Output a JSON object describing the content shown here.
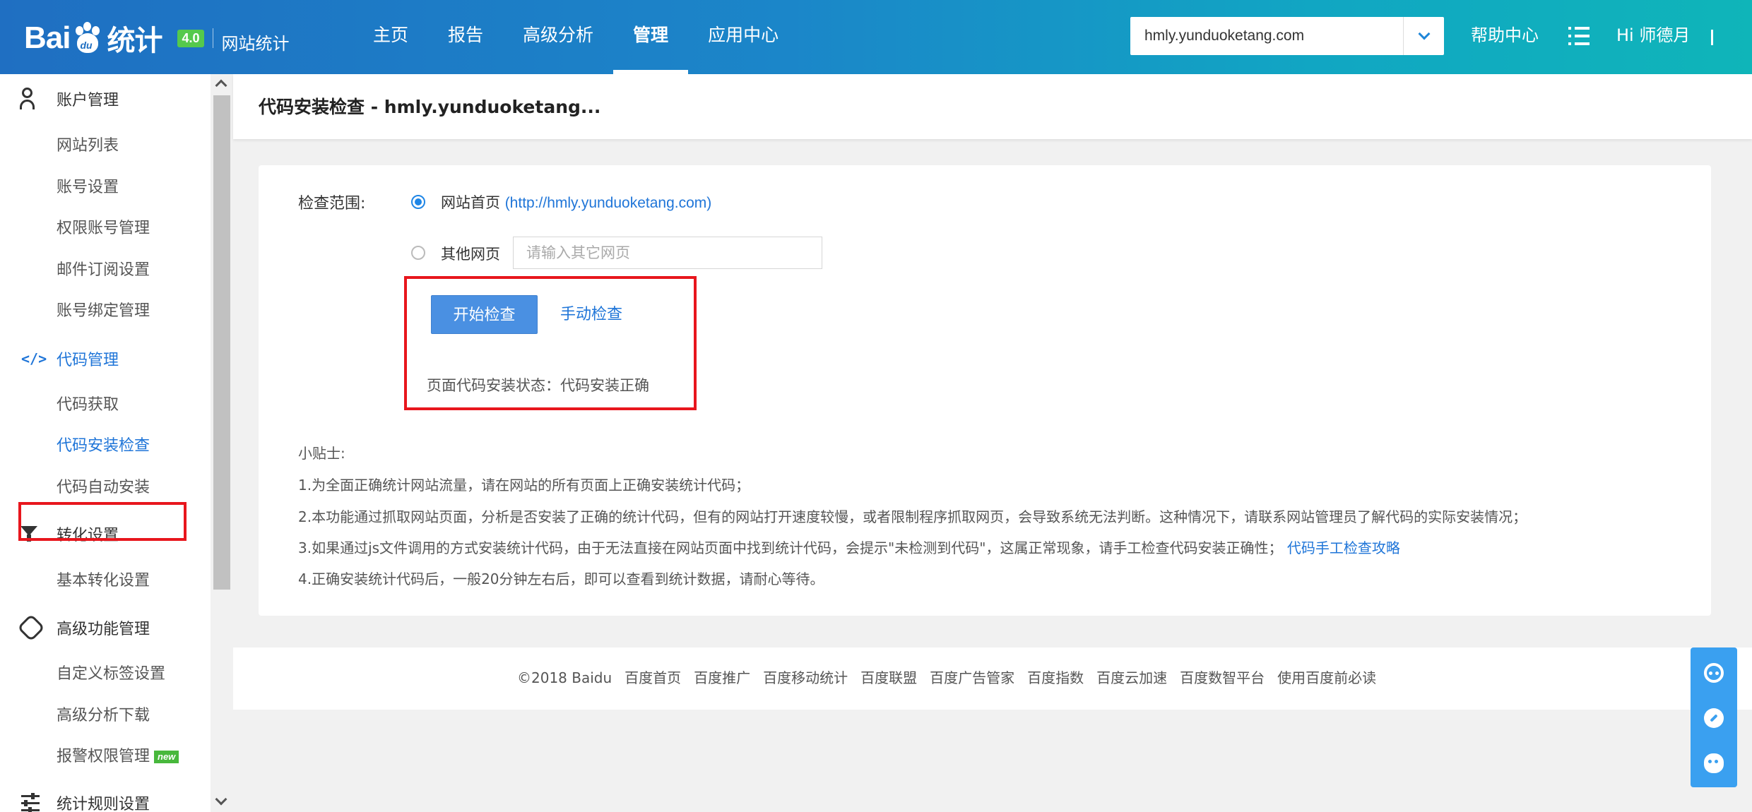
{
  "header": {
    "logo_text_a": "Bai",
    "logo_paw_text": "du",
    "logo_text_b": "统计",
    "logo_badge": "4.0",
    "logo_sub": "网站统计",
    "nav": [
      {
        "label": "主页",
        "active": false
      },
      {
        "label": "报告",
        "active": false
      },
      {
        "label": "高级分析",
        "active": false
      },
      {
        "label": "管理",
        "active": true
      },
      {
        "label": "应用中心",
        "active": false
      }
    ],
    "site_select_value": "hmly.yunduoketang.com",
    "help": "帮助中心",
    "greeting": "Hi 师德月"
  },
  "sidebar": {
    "groups": [
      {
        "label": "账户管理",
        "icon": "user-icon"
      },
      {
        "label": "代码管理",
        "icon": "code-icon"
      },
      {
        "label": "转化设置",
        "icon": "funnel-icon"
      },
      {
        "label": "高级功能管理",
        "icon": "puzzle-icon"
      },
      {
        "label": "统计规则设置",
        "icon": "sliders-icon"
      }
    ],
    "account_items": [
      "网站列表",
      "账号设置",
      "权限账号管理",
      "邮件订阅设置",
      "账号绑定管理"
    ],
    "code_items": [
      "代码获取",
      "代码安装检查",
      "代码自动安装"
    ],
    "conversion_items": [
      "基本转化设置"
    ],
    "advanced_items": [
      "自定义标签设置",
      "高级分析下载",
      "报警权限管理"
    ],
    "new_badge": "new",
    "active_item": "代码安装检查"
  },
  "main": {
    "page_title": "代码安装检查 - hmly.yunduoketang...",
    "range_label": "检查范围:",
    "option_home": "网站首页",
    "option_home_url": "(http://hmly.yunduoketang.com)",
    "option_other": "其他网页",
    "other_placeholder": "请输入其它网页",
    "start_button": "开始检查",
    "manual_link": "手动检查",
    "status": "页面代码安装状态：代码安装正确",
    "tips_title": "小贴士:",
    "tips": [
      "1.为全面正确统计网站流量，请在网站的所有页面上正确安装统计代码；",
      "2.本功能通过抓取网站页面，分析是否安装了正确的统计代码，但有的网站打开速度较慢，或者限制程序抓取网页，会导致系统无法判断。这种情况下，请联系网站管理员了解代码的实际安装情况；",
      "3.如果通过js文件调用的方式安装统计代码，由于无法直接在网站页面中找到统计代码，会提示\"未检测到代码\"，这属正常现象，请手工检查代码安装正确性；",
      "4.正确安装统计代码后，一般20分钟左右后，即可以查看到统计数据，请耐心等待。"
    ],
    "tips_link": "代码手工检查攻略"
  },
  "footer": {
    "links": [
      "©2018 Baidu",
      "百度首页",
      "百度推广",
      "百度移动统计",
      "百度联盟",
      "百度广告管家",
      "百度指数",
      "百度云加速",
      "百度数智平台",
      "使用百度前必读"
    ]
  },
  "colors": {
    "accent": "#1f75d8",
    "button": "#4a90e2",
    "highlight_red": "#e8161d",
    "new_badge": "#48b83c"
  }
}
